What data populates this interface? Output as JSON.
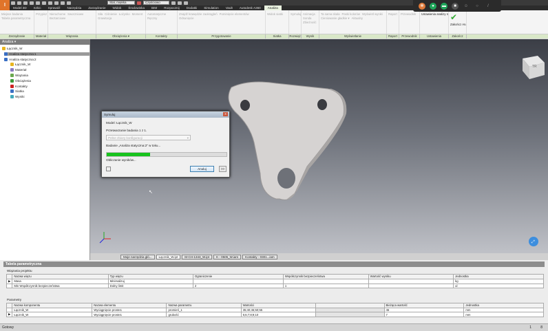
{
  "quick_access": {
    "material": "Stal, miękka",
    "appearance": "Częściowo"
  },
  "ribbon_tabs": [
    "Model 3D",
    "Szkic",
    "Sprawdź",
    "Narzędzia",
    "Zarządzanie",
    "Widok",
    "Środowiska",
    "BIM",
    "Rozpocznij",
    "Dodatki",
    "Simulation",
    "Vault",
    "Autodesk A360",
    "Analiza"
  ],
  "ribbon_groups": [
    {
      "label": "Zarządzanie",
      "items": [
        "Miejsce badania",
        "Tabela parametryczna"
      ]
    },
    {
      "label": "Materiał",
      "items": [
        "Przypisz"
      ]
    },
    {
      "label": "Wiązania",
      "items": [
        "Nieruchome",
        "Sworzniowe",
        "Beztarciowe"
      ]
    },
    {
      "label": "Obciążenia ▾",
      "items": [
        "Siła",
        "Ciśnienie",
        "Łożysko",
        "Moment",
        "Grawitacja"
      ]
    },
    {
      "label": "Kontakty",
      "items": [
        "Automatyczne",
        "Ręczny"
      ]
    },
    {
      "label": "Przygotowanie",
      "items": [
        "Znajdź krawędzie zaokrągleń",
        "Pominięcie elementów",
        "Odsunięcie"
      ]
    },
    {
      "label": "Siatka",
      "items": [
        "Widok siatki"
      ]
    },
    {
      "label": "Rozwiąż",
      "items": [
        "Symuluj"
      ]
    },
    {
      "label": "Wynik",
      "items": [
        "Animacja",
        "Sonda",
        "Zbieżność"
      ]
    },
    {
      "label": "Wyświetlanie",
      "items": [
        "Ta sama skala",
        "Paski kolorów",
        "Wyświetl wyniki",
        "Cieniowanie gładkie ▾",
        "Aktualny"
      ]
    },
    {
      "label": "Raport",
      "items": [
        "Raport"
      ]
    },
    {
      "label": "Przewodnik",
      "items": [
        "Przewodnik"
      ]
    },
    {
      "label": "Ustawienia",
      "items": [
        "Ustawienia analizy naprężeń"
      ]
    },
    {
      "label": "Zakończ",
      "items": [
        "Zakończ Analiza"
      ]
    }
  ],
  "browser": {
    "title": "Analiza ▾",
    "items": [
      "Łącznik_W",
      "Analiza statyczna:1",
      "Analiza statyczna:2",
      "Łącznik_W",
      "Materiał",
      "Wiązania",
      "Obciążenia",
      "Kontakty",
      "Siatka",
      "Wyniki"
    ]
  },
  "dialog": {
    "title": "Symuluj",
    "model": "Model: Łącznik_W",
    "processing": "Przetwarzanie badania 1 z 1.",
    "config": "Pełne zbiory konfiguracji",
    "study": "Badanie „Analiza statyczna:2\" w toku...",
    "progress": 0.36,
    "calc": "Obliczanie wyników...",
    "cancel": "Anuluj",
    "more": ">>"
  },
  "doc_tabs": [
    "Moje narzędzia głó...",
    "Łącznik_W.ipt",
    "M-CH-1343_W.ipt",
    "K - 0505_W.iam",
    "Kontakty - 0301...iam"
  ],
  "param_table": {
    "title": "Tabela parametryczna",
    "constraints_label": "Wiązania projektu",
    "constraints_headers": [
      "Nazwa więzu",
      "Typ więzu",
      "Ograniczenie",
      "Współczynnik bezpieczeństwa",
      "Wartość wyniku",
      "Jednostka"
    ],
    "constraints_rows": [
      [
        "Masa",
        "Minimalizuj",
        "",
        "",
        "",
        "kg"
      ],
      [
        "Min Współczynnik bezpieczeństwa",
        "Dolny limit",
        "2",
        "1",
        "",
        "ul"
      ]
    ],
    "params_label": "Parametry",
    "params_headers": [
      "Nazwa komponentu",
      "Nazwa elementu",
      "Nazwa parametru",
      "Wartości",
      "",
      "Bieżąca wartość",
      "Jednostka"
    ],
    "params_rows": [
      [
        "Łącznik_W",
        "Wyciągnięcie proste1",
        "promień_1",
        "35;40;45;50;55",
        "",
        "45",
        "mm"
      ],
      [
        "Łącznik_W",
        "Wyciągnięcie proste1",
        "grubość",
        "5;6;7;8;9;10",
        "",
        "7",
        "mm"
      ]
    ]
  },
  "status": {
    "text": "Gotowy",
    "count1": "1",
    "count2": "8"
  },
  "viewcube_label": "TR"
}
